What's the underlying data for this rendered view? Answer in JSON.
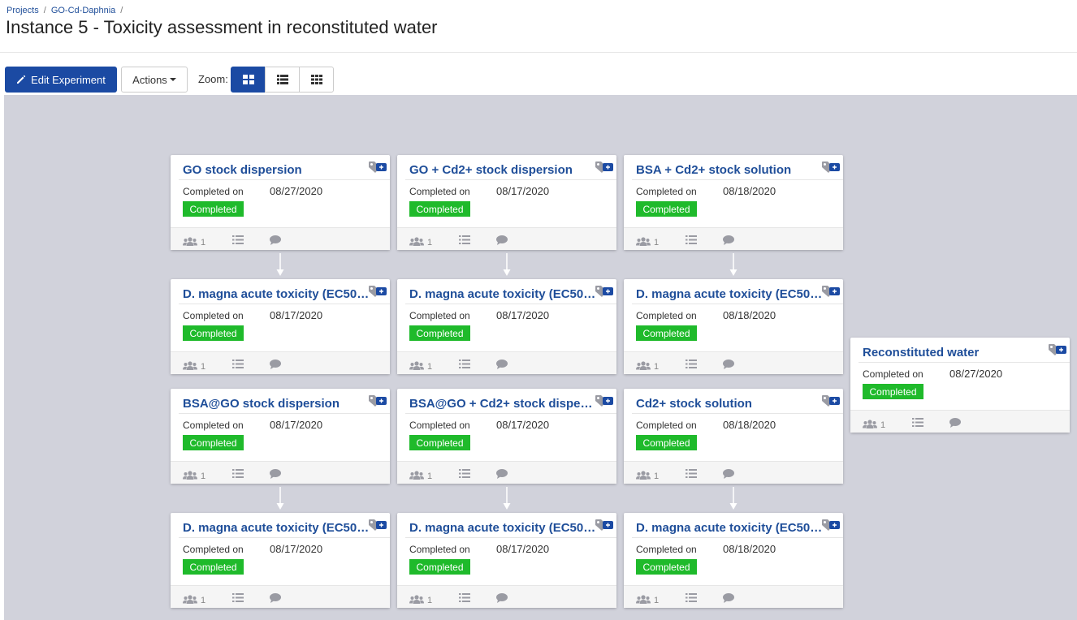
{
  "breadcrumb": {
    "items": [
      "Projects",
      "GO-Cd-Daphnia"
    ],
    "separator": "/"
  },
  "page_title": "Instance 5 - Toxicity assessment in reconstituted water",
  "toolbar": {
    "edit_label": "Edit Experiment",
    "actions_label": "Actions",
    "zoom_label": "Zoom:",
    "zoom_options": [
      "large-grid-icon",
      "list-icon",
      "small-grid-icon"
    ],
    "zoom_selected": 0
  },
  "colors": {
    "primary": "#1b4aa3",
    "status_completed": "#1fba2b",
    "canvas_bg": "#d1d2db",
    "title_link": "#1f4e99"
  },
  "card_common": {
    "completed_label": "Completed on",
    "status": "Completed",
    "user_count": "1"
  },
  "cards": [
    {
      "title": "GO stock dispersion",
      "date": "08/27/2020"
    },
    {
      "title": "GO + Cd2+ stock dispersion",
      "date": "08/17/2020"
    },
    {
      "title": "BSA + Cd2+ stock solution",
      "date": "08/18/2020"
    },
    {
      "title": "D. magna acute toxicity (EC50…",
      "date": "08/17/2020"
    },
    {
      "title": "D. magna acute toxicity (EC50…",
      "date": "08/17/2020"
    },
    {
      "title": "D. magna acute toxicity (EC50…",
      "date": "08/18/2020"
    },
    {
      "title": "BSA@GO stock dispersion",
      "date": "08/17/2020"
    },
    {
      "title": "BSA@GO + Cd2+ stock disper…",
      "date": "08/17/2020"
    },
    {
      "title": "Cd2+ stock solution",
      "date": "08/18/2020"
    },
    {
      "title": "D. magna acute toxicity (EC50…",
      "date": "08/17/2020"
    },
    {
      "title": "D. magna acute toxicity (EC50…",
      "date": "08/17/2020"
    },
    {
      "title": "D. magna acute toxicity (EC50…",
      "date": "08/18/2020"
    },
    {
      "title": "Reconstituted water",
      "date": "08/27/2020"
    }
  ]
}
